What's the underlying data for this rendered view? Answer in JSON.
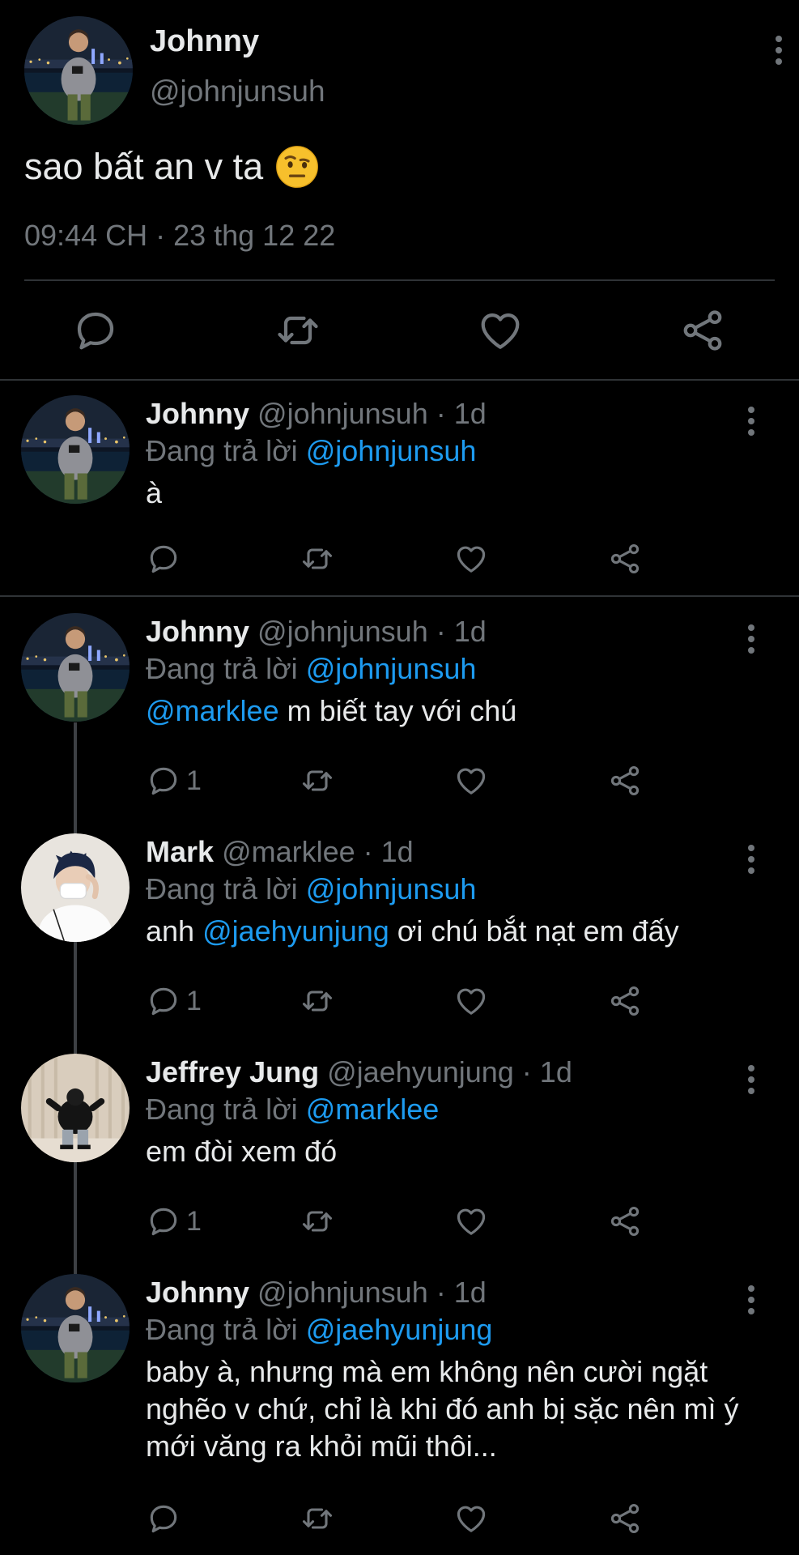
{
  "main_tweet": {
    "name": "Johnny",
    "handle": "@johnjunsuh",
    "text": "sao bất an v ta",
    "emoji_icon": "face-with-raised-eyebrow-emoji",
    "timestamp": "09:44 CH · 23 thg 12 22"
  },
  "icons": {
    "reply": "comment-icon",
    "retweet": "retweet-icon",
    "like": "heart-icon",
    "share": "share-icon",
    "more": "more-vertical-icon"
  },
  "colors": {
    "background": "#000000",
    "text": "#e7e9ea",
    "muted": "#71767b",
    "link": "#1d9bf0",
    "divider": "#2f3336"
  },
  "replies": [
    {
      "name": "Johnny",
      "handle": "@johnjunsuh · 1d",
      "replying_label": "Đang trả lời ",
      "replying_to": "@johnjunsuh",
      "text": "à",
      "reply_count": ""
    },
    {
      "name": "Johnny",
      "handle": "@johnjunsuh · 1d",
      "replying_label": "Đang trả lời ",
      "replying_to": "@johnjunsuh",
      "mention": "@marklee",
      "text": " m biết tay với chú",
      "reply_count": "1"
    },
    {
      "name": "Mark",
      "handle": "@marklee · 1d",
      "replying_label": "Đang trả lời ",
      "replying_to": "@johnjunsuh",
      "text_before": "anh ",
      "mention": "@jaehyunjung",
      "text": " ơi chú bắt nạt em đấy",
      "reply_count": "1"
    },
    {
      "name": "Jeffrey Jung",
      "handle": "@jaehyunjung · 1d",
      "replying_label": "Đang trả lời ",
      "replying_to": "@marklee",
      "text": "em đòi xem đó",
      "reply_count": "1"
    },
    {
      "name": "Johnny",
      "handle": "@johnjunsuh · 1d",
      "replying_label": "Đang trả lời ",
      "replying_to": "@jaehyunjung",
      "text": "baby à, nhưng mà em không nên cười ngặt nghẽo v chứ, chỉ là khi đó anh bị sặc nên mì ý mới văng ra khỏi mũi thôi...",
      "reply_count": ""
    }
  ]
}
